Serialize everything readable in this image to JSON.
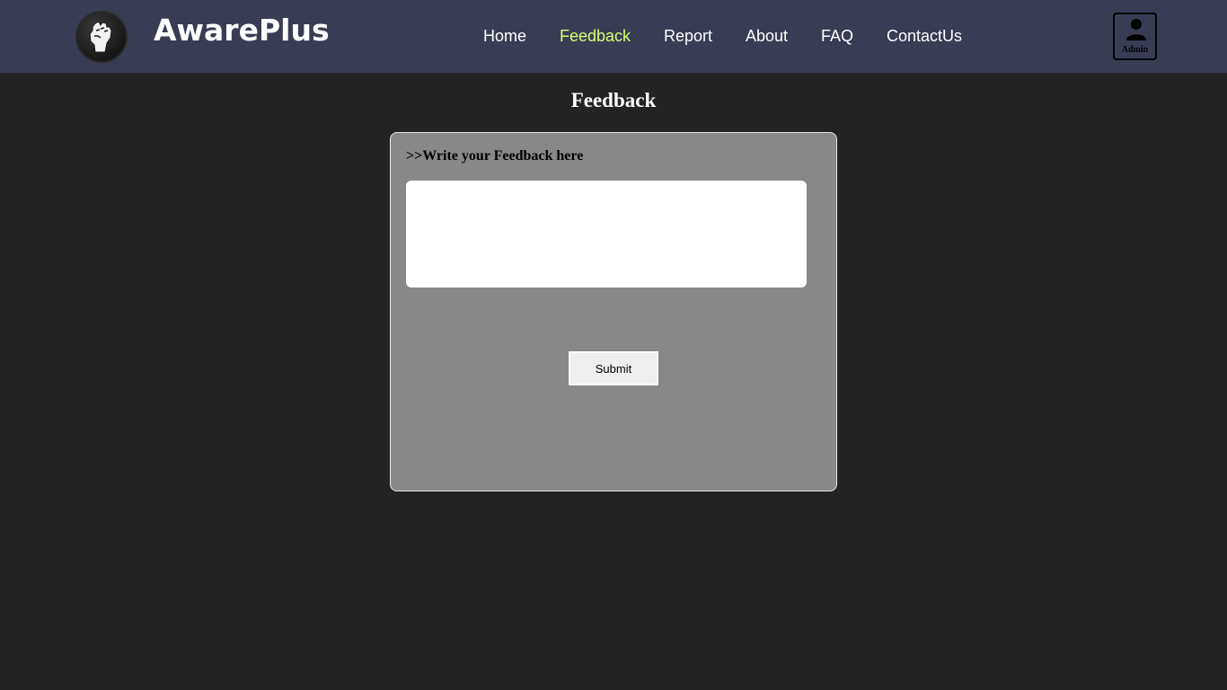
{
  "brand": {
    "name": "AwarePlus",
    "logo_icon": "raised-fist-icon"
  },
  "nav": {
    "items": [
      {
        "label": "Home"
      },
      {
        "label": "Feedback"
      },
      {
        "label": "Report"
      },
      {
        "label": "About"
      },
      {
        "label": "FAQ"
      },
      {
        "label": "ContactUs"
      }
    ],
    "active": "Feedback",
    "active_color": "#d6ff7a"
  },
  "admin": {
    "label": "Admin",
    "icon": "user-icon"
  },
  "page": {
    "title": "Feedback"
  },
  "form": {
    "prompt": ">>Write your Feedback here",
    "feedback_value": "",
    "submit_label": "Submit"
  },
  "colors": {
    "navbar_bg": "#393d53",
    "page_bg": "#232323",
    "card_bg": "#888888"
  }
}
